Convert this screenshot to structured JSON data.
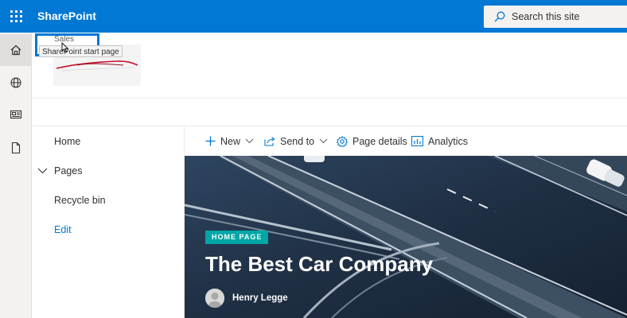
{
  "app": {
    "brand": "SharePoint"
  },
  "search": {
    "placeholder": "Search this site"
  },
  "appbar": {
    "items": [
      "home-icon",
      "globe-icon",
      "news-icon",
      "file-icon"
    ]
  },
  "site": {
    "name": "Sales"
  },
  "tooltip": {
    "label": "SharePoint start page"
  },
  "quicklaunch": {
    "items": [
      "Home",
      "Pages",
      "Recycle bin"
    ],
    "edit_label": "Edit"
  },
  "commandbar": {
    "new_label": "New",
    "send_to_label": "Send to",
    "page_details_label": "Page details",
    "analytics_label": "Analytics"
  },
  "hero": {
    "badge": "HOME PAGE",
    "title": "The Best Car Company",
    "author": "Henry Legge"
  },
  "colors": {
    "suitebar": "#0078d4",
    "accent": "#0078d4",
    "badge": "#03a6a6"
  }
}
